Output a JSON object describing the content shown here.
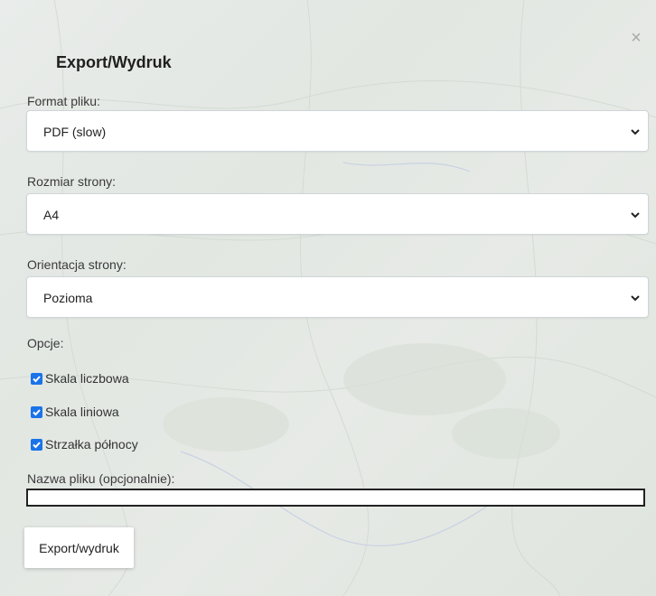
{
  "dialog": {
    "title": "Export/Wydruk",
    "close_symbol": "×"
  },
  "format": {
    "label": "Format pliku:",
    "value": "PDF (slow)"
  },
  "page_size": {
    "label": "Rozmiar strony:",
    "value": "A4"
  },
  "orientation": {
    "label": "Orientacja strony:",
    "value": "Pozioma"
  },
  "options": {
    "label": "Opcje:",
    "items": [
      {
        "label": "Skala liczbowa",
        "checked": true
      },
      {
        "label": "Skala liniowa",
        "checked": true
      },
      {
        "label": "Strzałka północy",
        "checked": true
      }
    ]
  },
  "filename": {
    "label": "Nazwa pliku (opcjonalnie):",
    "value": ""
  },
  "export_button": {
    "label": "Export/wydruk"
  },
  "colors": {
    "checkbox": "#1a73e8",
    "close_icon": "#a9a9a9"
  }
}
